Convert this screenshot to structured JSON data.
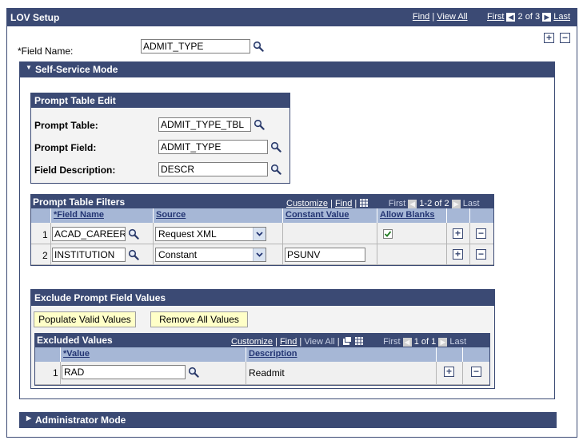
{
  "header": {
    "title": "LOV Setup",
    "find": "Find",
    "view_all": "View All",
    "first": "First",
    "count": "2 of 3",
    "last": "Last"
  },
  "field_name": {
    "label": "*Field Name:",
    "value": "ADMIT_TYPE"
  },
  "self_service": {
    "title": "Self-Service Mode"
  },
  "prompt_table_edit": {
    "title": "Prompt Table Edit",
    "prompt_table_label": "Prompt Table:",
    "prompt_table_value": "ADMIT_TYPE_TBL",
    "prompt_field_label": "Prompt Field:",
    "prompt_field_value": "ADMIT_TYPE",
    "field_desc_label": "Field Description:",
    "field_desc_value": "DESCR"
  },
  "filters": {
    "title": "Prompt Table Filters",
    "customize": "Customize",
    "find": "Find",
    "first": "First",
    "count": "1-2 of 2",
    "last": "Last",
    "columns": [
      "*Field Name",
      "Source",
      "Constant Value",
      "Allow Blanks"
    ],
    "rows": [
      {
        "num": "1",
        "field": "ACAD_CAREER",
        "source": "Request XML",
        "constant": "",
        "allow_blanks": true
      },
      {
        "num": "2",
        "field": "INSTITUTION",
        "source": "Constant",
        "constant": "PSUNV",
        "allow_blanks": false
      }
    ]
  },
  "exclude": {
    "title": "Exclude Prompt Field Values",
    "populate_btn": "Populate Valid Values",
    "remove_btn": "Remove All Values",
    "grid_title": "Excluded Values",
    "customize": "Customize",
    "find": "Find",
    "view_all": "View All",
    "first": "First",
    "count": "1 of 1",
    "last": "Last",
    "columns": [
      "*Value",
      "Description"
    ],
    "rows": [
      {
        "num": "1",
        "value": "RAD",
        "description": "Readmit"
      }
    ]
  },
  "admin_mode": {
    "title": "Administrator Mode"
  },
  "icons": {
    "lookup": "magnifier-icon",
    "add": "plus-icon",
    "delete": "minus-icon"
  },
  "colors": {
    "header_bg": "#3b4a74",
    "column_header_bg": "#a6b7d6",
    "button_bg": "#ffffc8"
  }
}
